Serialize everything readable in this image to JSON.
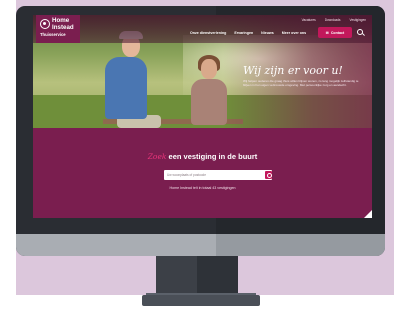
{
  "logo": {
    "brand_line1": "Home",
    "brand_line2": "Instead",
    "subtitle": "Thuisservice"
  },
  "header": {
    "top_links": [
      "Vacatures",
      "Downloads",
      "Vestigingen"
    ],
    "nav": [
      "Onze dienstverlening",
      "Ervaringen",
      "Nieuws",
      "Meer over ons"
    ],
    "contact_label": "Contact"
  },
  "hero": {
    "title": "Wij zijn er voor u!",
    "text": "Wij helpen ouderen die graag thuis willen blijven wonen, zo lang mogelijk zelfstandig te blijven in hun eigen vertrouwde omgeving. Met persoonlijke zorg en aandacht."
  },
  "finder": {
    "title_accent": "Zoek",
    "title_rest": " een vestiging in de buurt",
    "input_placeholder": "Uw woonplaats of postcode",
    "note": "Home Instead telt in totaal 43 vestigingen"
  },
  "colors": {
    "brand": "#7a1e4f",
    "accent": "#c2185b",
    "accent_text": "#e8347a"
  }
}
